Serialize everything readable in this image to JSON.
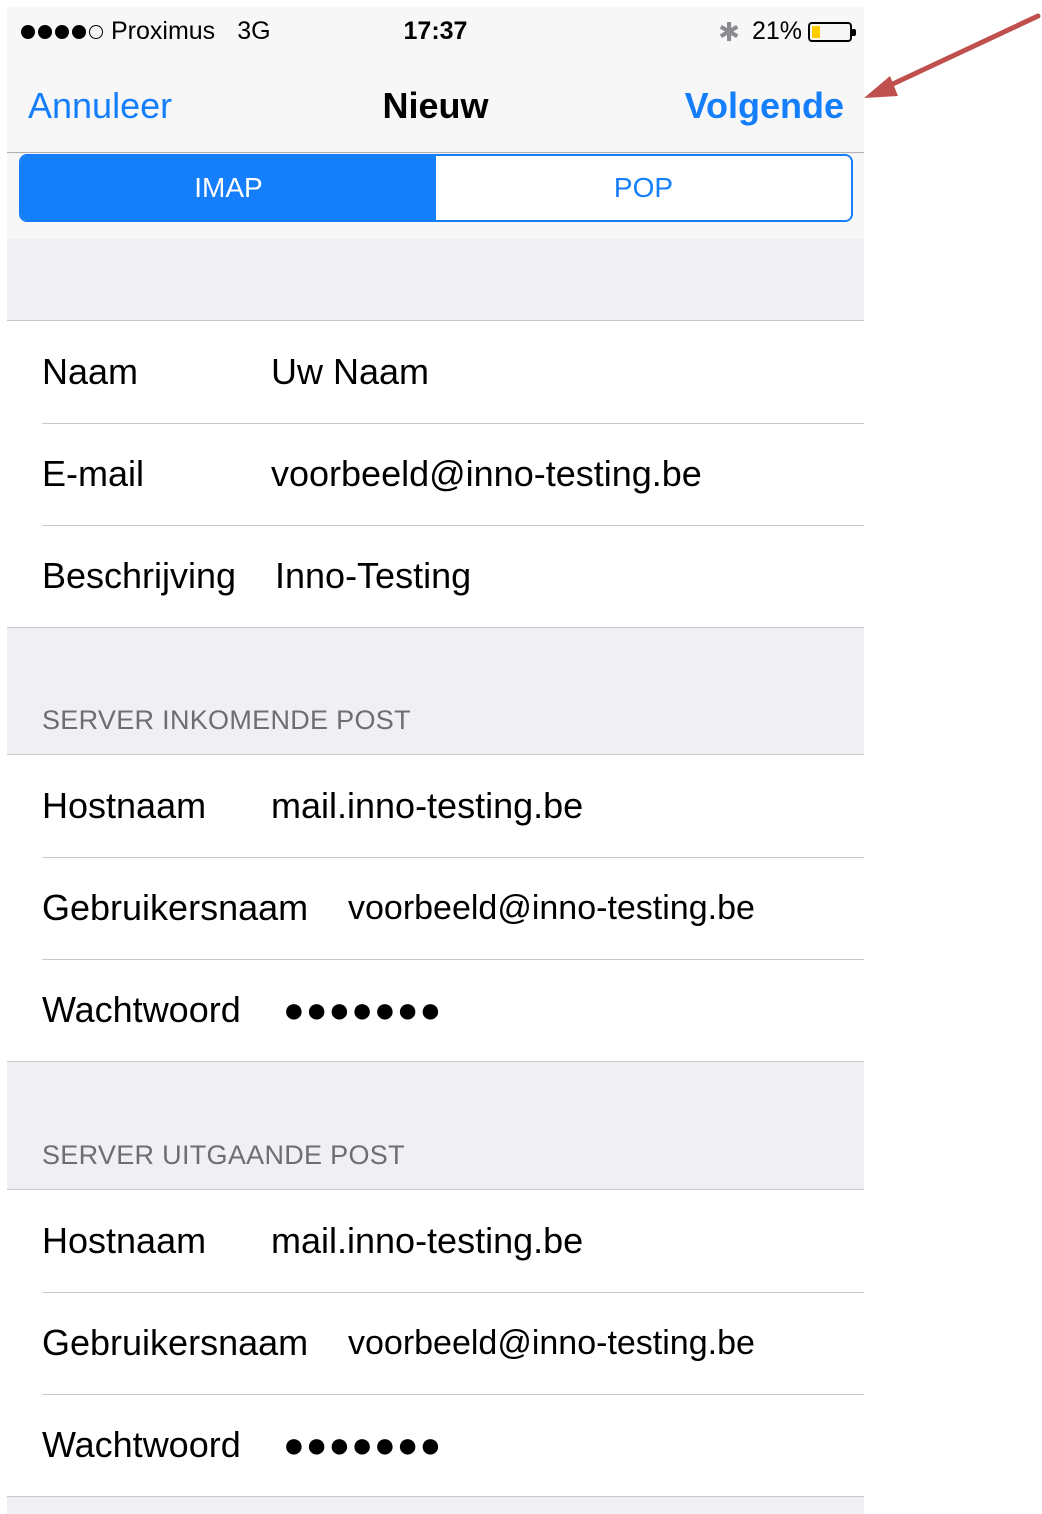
{
  "status_bar": {
    "carrier": "Proximus",
    "network": "3G",
    "time": "17:37",
    "bluetooth_icon": "bluetooth-icon",
    "battery_percent": "21%",
    "battery_level": 0.21,
    "signal_bars": 4,
    "signal_max": 5
  },
  "nav": {
    "cancel_label": "Annuleer",
    "title": "Nieuw",
    "next_label": "Volgende"
  },
  "segments": [
    {
      "label": "IMAP",
      "selected": true
    },
    {
      "label": "POP",
      "selected": false
    }
  ],
  "account": {
    "rows": [
      {
        "label": "Naam",
        "value": "Uw Naam"
      },
      {
        "label": "E-mail",
        "value": "voorbeeld@inno-testing.be"
      },
      {
        "label": "Beschrijving",
        "value": "Inno-Testing"
      }
    ]
  },
  "incoming": {
    "header": "SERVER INKOMENDE POST",
    "rows": [
      {
        "label": "Hostnaam",
        "value": "mail.inno-testing.be"
      },
      {
        "label": "Gebruikersnaam",
        "value": "voorbeeld@inno-testing.be"
      },
      {
        "label": "Wachtwoord",
        "value": "●●●●●●●"
      }
    ]
  },
  "outgoing": {
    "header": "SERVER UITGAANDE POST",
    "rows": [
      {
        "label": "Hostnaam",
        "value": "mail.inno-testing.be"
      },
      {
        "label": "Gebruikersnaam",
        "value": "voorbeeld@inno-testing.be"
      },
      {
        "label": "Wachtwoord",
        "value": "●●●●●●●"
      }
    ]
  },
  "colors": {
    "accent": "#147efb",
    "annotation_arrow": "#c0504d",
    "battery": "#ffcc00"
  }
}
